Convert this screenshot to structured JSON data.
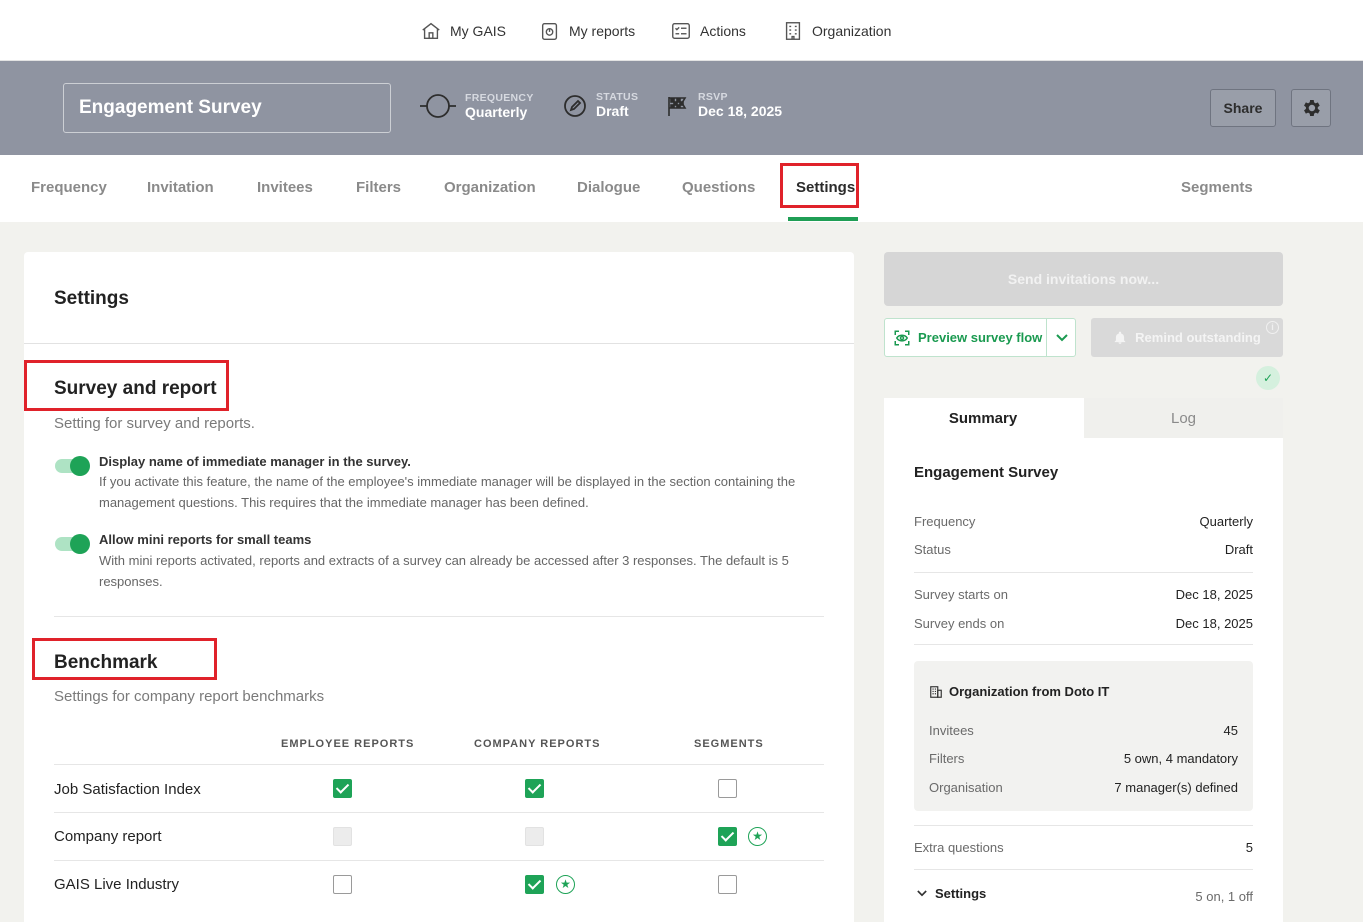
{
  "topnav": {
    "items": [
      {
        "label": "My GAIS",
        "icon": "home-icon"
      },
      {
        "label": "My reports",
        "icon": "reports-icon"
      },
      {
        "label": "Actions",
        "icon": "actions-icon"
      },
      {
        "label": "Organization",
        "icon": "building-icon"
      }
    ]
  },
  "survey": {
    "title": "Engagement Survey",
    "frequency_label": "FREQUENCY",
    "frequency_value": "Quarterly",
    "status_label": "STATUS",
    "status_value": "Draft",
    "rsvp_label": "RSVP",
    "rsvp_value": "Dec 18, 2025",
    "share_label": "Share"
  },
  "tabs": [
    "Frequency",
    "Invitation",
    "Invitees",
    "Filters",
    "Organization",
    "Dialogue",
    "Questions",
    "Settings",
    "Segments"
  ],
  "settings": {
    "title": "Settings",
    "survey_report": {
      "title": "Survey and report",
      "subtitle": "Setting for survey and reports.",
      "options": [
        {
          "title": "Display name of immediate manager in the survey.",
          "desc": "If you activate this feature, the name of the employee's immediate manager will be displayed in the section containing the management questions. This requires that the immediate manager has been defined.",
          "enabled": true
        },
        {
          "title": "Allow mini reports for small teams",
          "desc": "With mini reports activated, reports and extracts of a survey can already be accessed after 3 responses. The default is 5 responses.",
          "enabled": true
        }
      ]
    },
    "benchmark": {
      "title": "Benchmark",
      "subtitle": "Settings for company report benchmarks",
      "columns": [
        "EMPLOYEE REPORTS",
        "COMPANY REPORTS",
        "SEGMENTS"
      ],
      "rows": [
        {
          "label": "Job Satisfaction Index",
          "employee": "checked",
          "company": "checked",
          "segments": "unchecked"
        },
        {
          "label": "Company report",
          "employee": "disabled",
          "company": "disabled",
          "segments": "checked-star"
        },
        {
          "label": "GAIS Live Industry",
          "employee": "unchecked",
          "company": "checked-star",
          "segments": "unchecked"
        }
      ]
    }
  },
  "actions": {
    "send": "Send invitations now...",
    "preview": "Preview survey flow",
    "remind": "Remind outstanding"
  },
  "summary": {
    "tab_summary": "Summary",
    "tab_log": "Log",
    "title": "Engagement Survey",
    "frequency_k": "Frequency",
    "frequency_v": "Quarterly",
    "status_k": "Status",
    "status_v": "Draft",
    "starts_k": "Survey starts on",
    "starts_v": "Dec 18, 2025",
    "ends_k": "Survey ends on",
    "ends_v": "Dec 18, 2025",
    "org_title": "Organization from Doto IT",
    "invitees_k": "Invitees",
    "invitees_v": "45",
    "filters_k": "Filters",
    "filters_v": "5 own, 4 mandatory",
    "organisation_k": "Organisation",
    "organisation_v": "7 manager(s) defined",
    "extra_k": "Extra questions",
    "extra_v": "5",
    "settings_k": "Settings",
    "settings_v": "5 on, 1 off"
  },
  "colors": {
    "accent": "#1ea357",
    "band": "#8f94a1",
    "highlight": "#e0222a"
  }
}
